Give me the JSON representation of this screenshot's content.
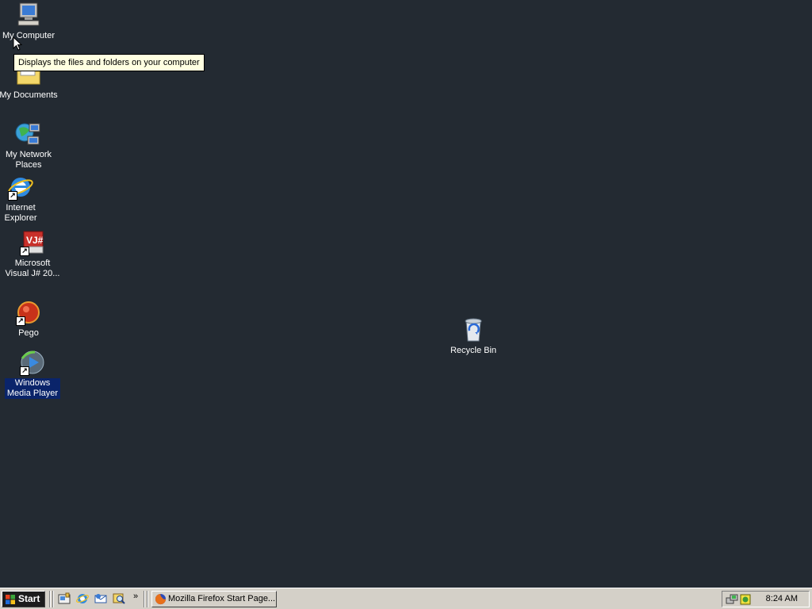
{
  "desktop": {
    "background": "#232a32",
    "icons": [
      {
        "id": "my-computer",
        "label": "My Computer",
        "icon": "computer-icon"
      },
      {
        "id": "my-documents",
        "label": "My Documents",
        "icon": "folder-icon"
      },
      {
        "id": "my-network-places",
        "label": "My Network Places",
        "icon": "network-icon"
      },
      {
        "id": "internet-explorer",
        "label": "Internet Explorer",
        "icon": "ie-icon"
      },
      {
        "id": "visual-jsharp",
        "label": "Microsoft Visual J# 20...",
        "icon": "vj-icon"
      },
      {
        "id": "pego",
        "label": "Pego",
        "icon": "pego-icon"
      },
      {
        "id": "windows-media-player",
        "label": "Windows Media Player",
        "icon": "media-player-icon",
        "selected": true
      },
      {
        "id": "recycle-bin",
        "label": "Recycle Bin",
        "icon": "recycle-bin-icon"
      }
    ],
    "tooltip": "Displays the files and folders on your computer"
  },
  "taskbar": {
    "start_label": "Start",
    "quick_launch": [
      {
        "icon": "show-desktop-icon"
      },
      {
        "icon": "ie-icon"
      },
      {
        "icon": "outlook-icon"
      },
      {
        "icon": "search-icon"
      }
    ],
    "more_label": "»",
    "tasks": [
      {
        "label": "Mozilla Firefox Start Page...",
        "icon": "firefox-icon"
      }
    ],
    "tray": {
      "icons": [
        "network-tray-icon",
        "security-tray-icon"
      ],
      "clock": "8:24 AM"
    }
  }
}
